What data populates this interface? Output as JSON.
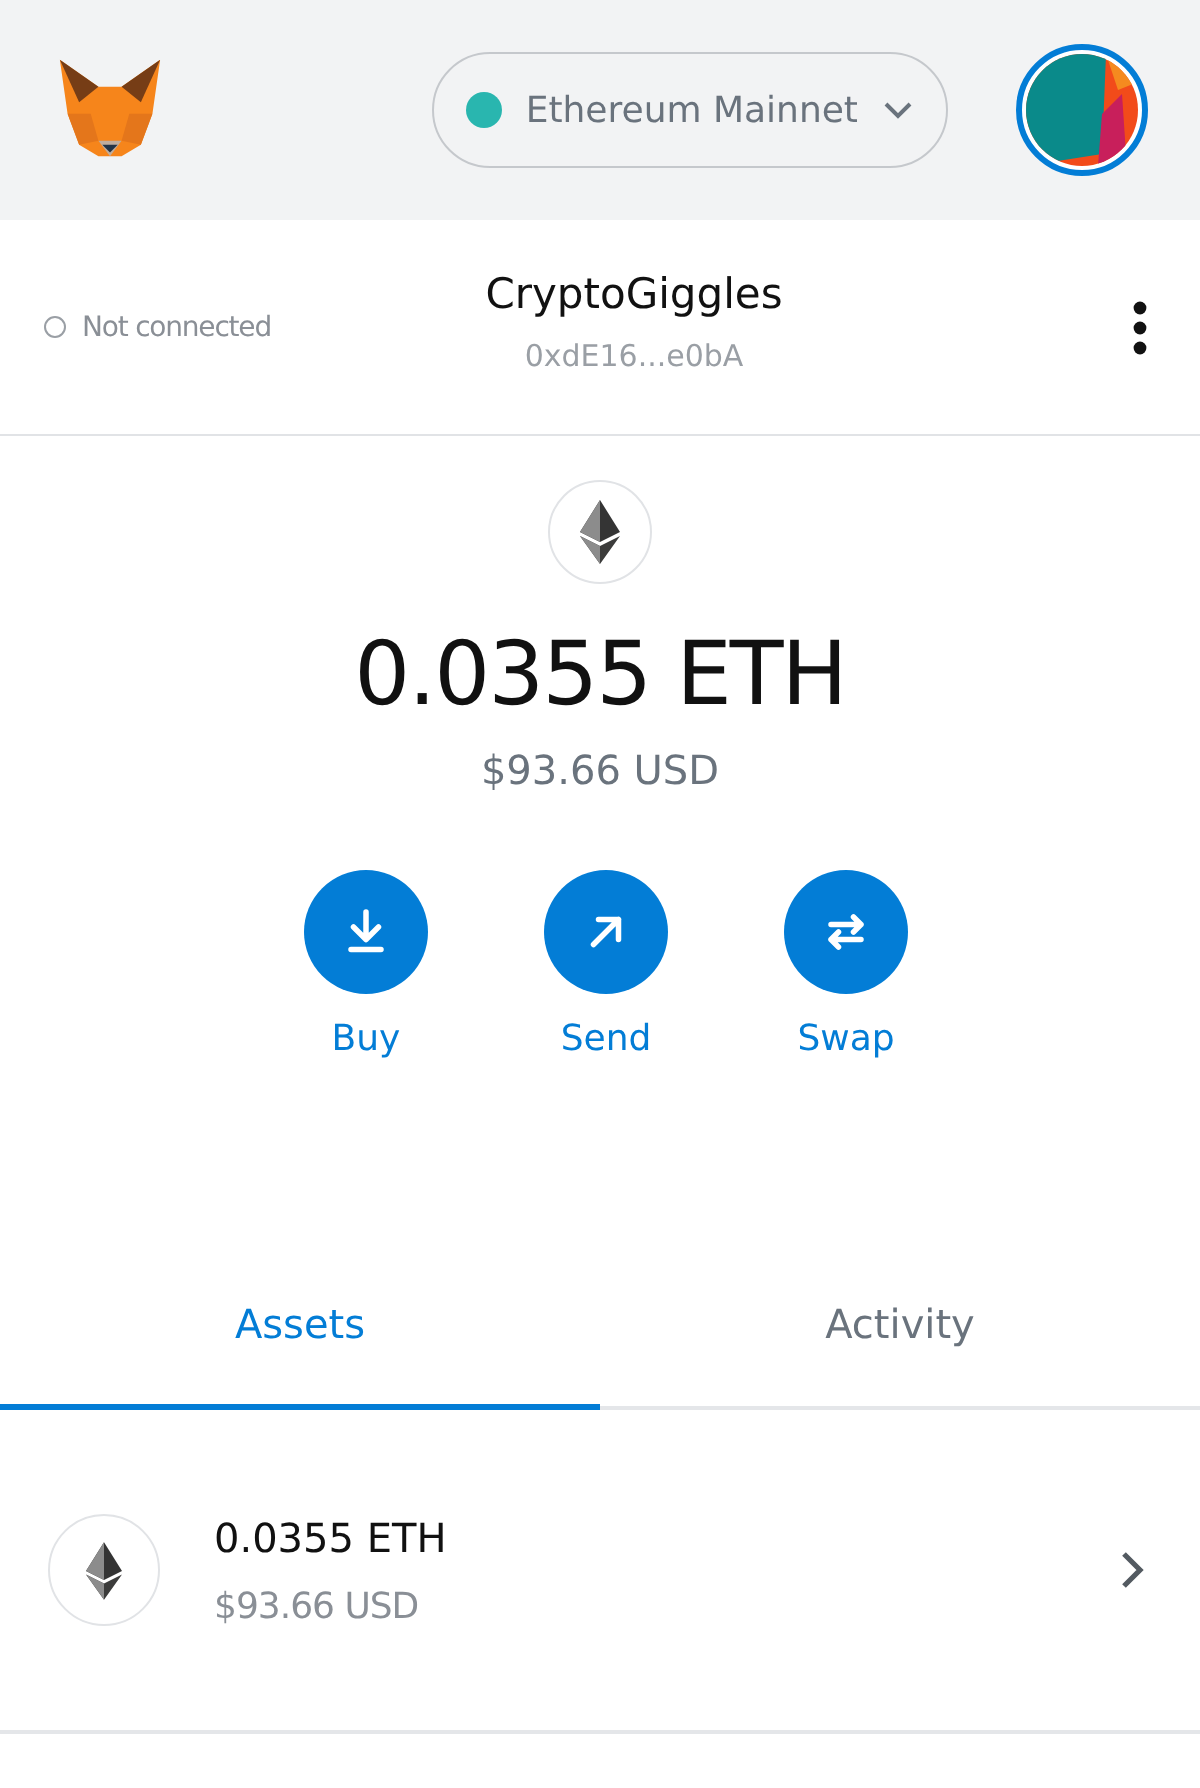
{
  "header": {
    "network": "Ethereum Mainnet"
  },
  "account": {
    "connection": "Not connected",
    "connected": false,
    "name": "CryptoGiggles",
    "address": "0xdE16...e0bA"
  },
  "balance": {
    "amount": "0.0355",
    "unit": "ETH",
    "fiat": "$93.66 USD"
  },
  "actions": [
    {
      "kind": "buy",
      "label": "Buy"
    },
    {
      "kind": "send",
      "label": "Send"
    },
    {
      "kind": "swap",
      "label": "Swap"
    }
  ],
  "tabs": [
    {
      "label": "Assets",
      "selected": true
    },
    {
      "label": "Activity",
      "selected": false
    }
  ],
  "assets": [
    {
      "amount": "0.0355 ETH",
      "fiat": "$93.66 USD"
    }
  ]
}
